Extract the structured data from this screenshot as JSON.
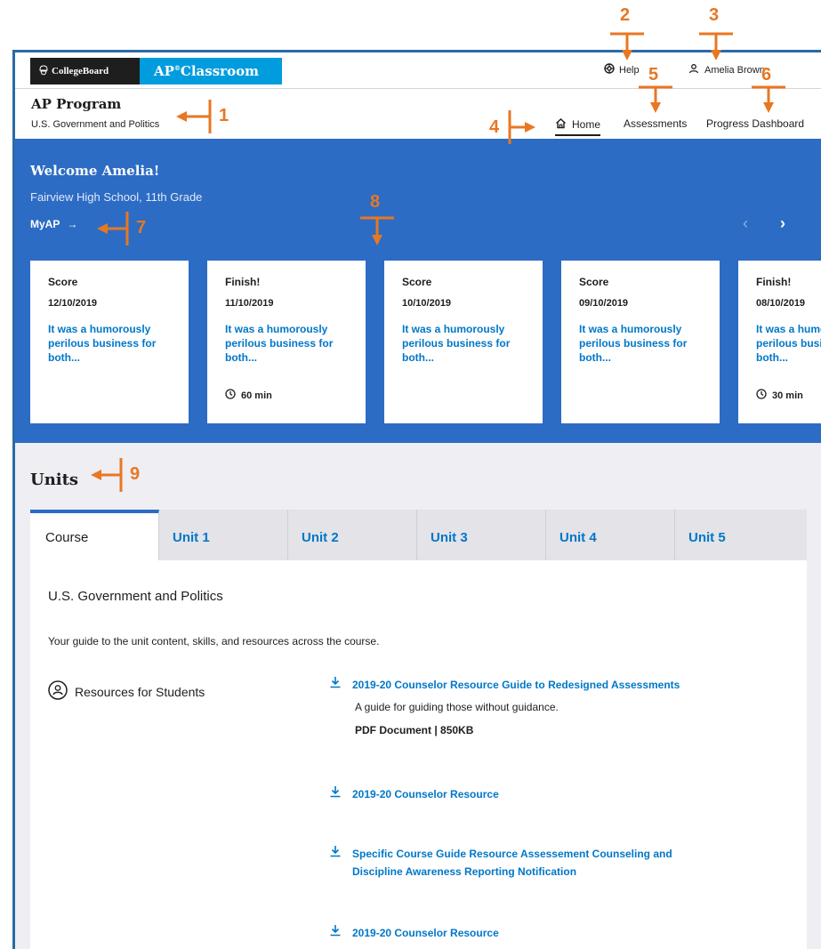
{
  "app": {
    "brand_logo": "CollegeBoard",
    "product": "AP Classroom",
    "product_sup": "®"
  },
  "header": {
    "help": "Help",
    "user": "Amelia Brown"
  },
  "subheader": {
    "program": "AP Program",
    "course": "U.S. Government and Politics"
  },
  "nav": {
    "home": "Home",
    "assessments": "Assessments",
    "progress": "Progress Dashboard"
  },
  "hero": {
    "welcome": "Welcome Amelia!",
    "school": "Fairview High School, 11th Grade",
    "myap": "MyAP",
    "cards": [
      {
        "type": "Score",
        "date": "12/10/2019",
        "desc": "It was a humorously perilous business for both...",
        "time": ""
      },
      {
        "type": "Finish!",
        "date": "11/10/2019",
        "desc": "It was a humorously perilous business for both...",
        "time": "60 min"
      },
      {
        "type": "Score",
        "date": "10/10/2019",
        "desc": "It was a humorously perilous business for both...",
        "time": ""
      },
      {
        "type": "Score",
        "date": "09/10/2019",
        "desc": "It was a humorously perilous business for both...",
        "time": ""
      },
      {
        "type": "Finish!",
        "date": "08/10/2019",
        "desc": "It was a humorously perilous business for both...",
        "time": "30 min"
      }
    ]
  },
  "units": {
    "title": "Units",
    "tabs": [
      "Course",
      "Unit 1",
      "Unit 2",
      "Unit 3",
      "Unit 4",
      "Unit 5"
    ],
    "course_title": "U.S. Government and Politics",
    "guide_text": "Your guide to the unit content, skills, and resources across the course.",
    "resources_label": "Resources for Students",
    "resources": [
      {
        "title": "2019-20 Counselor Resource Guide to Redesigned Assessments",
        "desc": "A guide for guiding those without guidance.",
        "meta": "PDF Document | 850KB"
      },
      {
        "title": "2019-20 Counselor Resource",
        "desc": "",
        "meta": ""
      },
      {
        "title": "Specific Course Guide Resource Assessement Counseling and Discipline Awareness Reporting Notification",
        "desc": "",
        "meta": ""
      },
      {
        "title": "2019-20 Counselor Resource",
        "desc": "",
        "meta": ""
      }
    ]
  },
  "annotations": [
    "1",
    "2",
    "3",
    "4",
    "5",
    "6",
    "7",
    "8",
    "9"
  ],
  "colors": {
    "hero_blue": "#2c6cc4",
    "brand_blue": "#009cde",
    "link_blue": "#0077c8",
    "annotation_orange": "#e87722"
  }
}
